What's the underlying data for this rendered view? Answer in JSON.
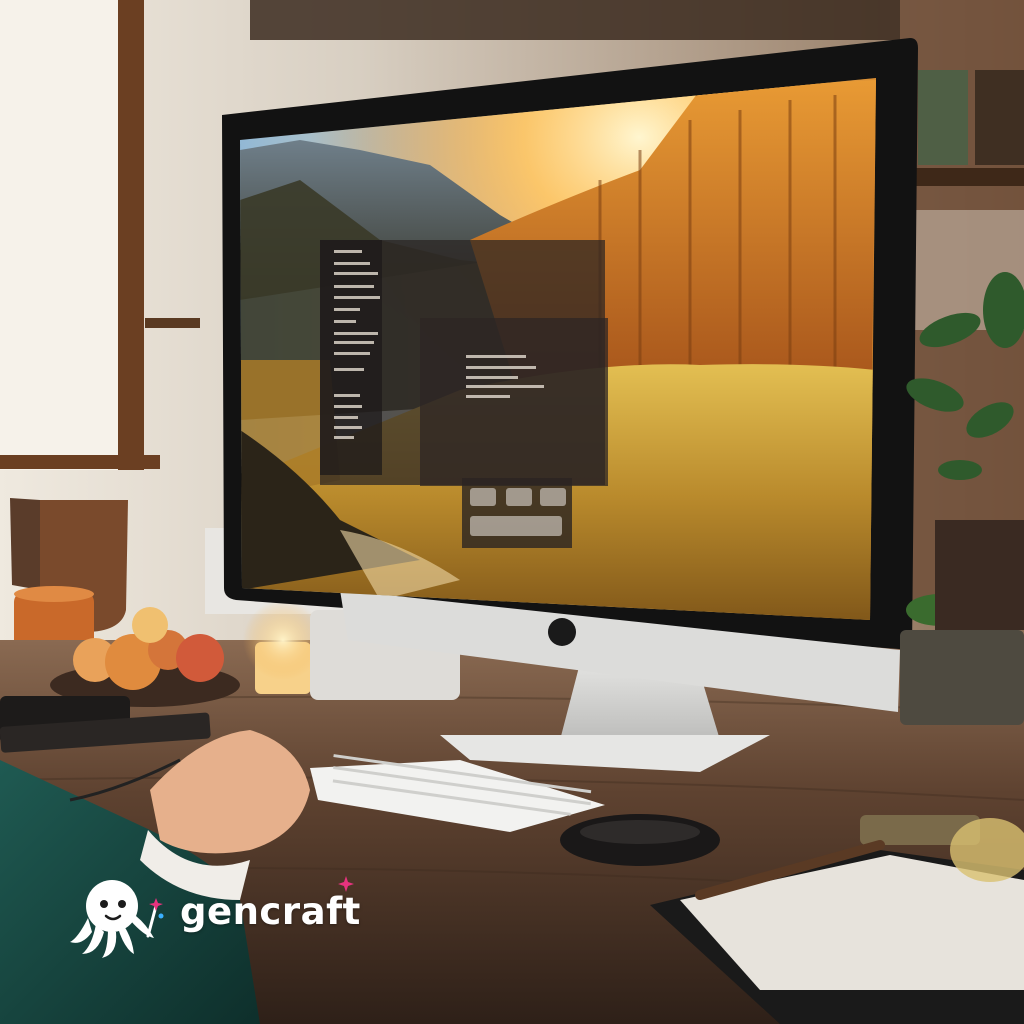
{
  "watermark": {
    "brand": "gencraft",
    "logo_icon": "octopus-mascot-icon",
    "star_color": "#e6337e"
  },
  "scene": {
    "description_icons": [
      "imac-monitor",
      "keyboard",
      "mouse",
      "fruit-bowl",
      "mug",
      "plant",
      "candle",
      "notebook",
      "hand"
    ],
    "colors": {
      "wall": "#d9d1c4",
      "desk": "#5a3d2a",
      "wallpaper_sky": "#e9a23b",
      "forest": "#c9761e",
      "meadow": "#c7a23a",
      "monitor_bezel": "#141414",
      "monitor_stand": "#d8d8d6"
    }
  }
}
